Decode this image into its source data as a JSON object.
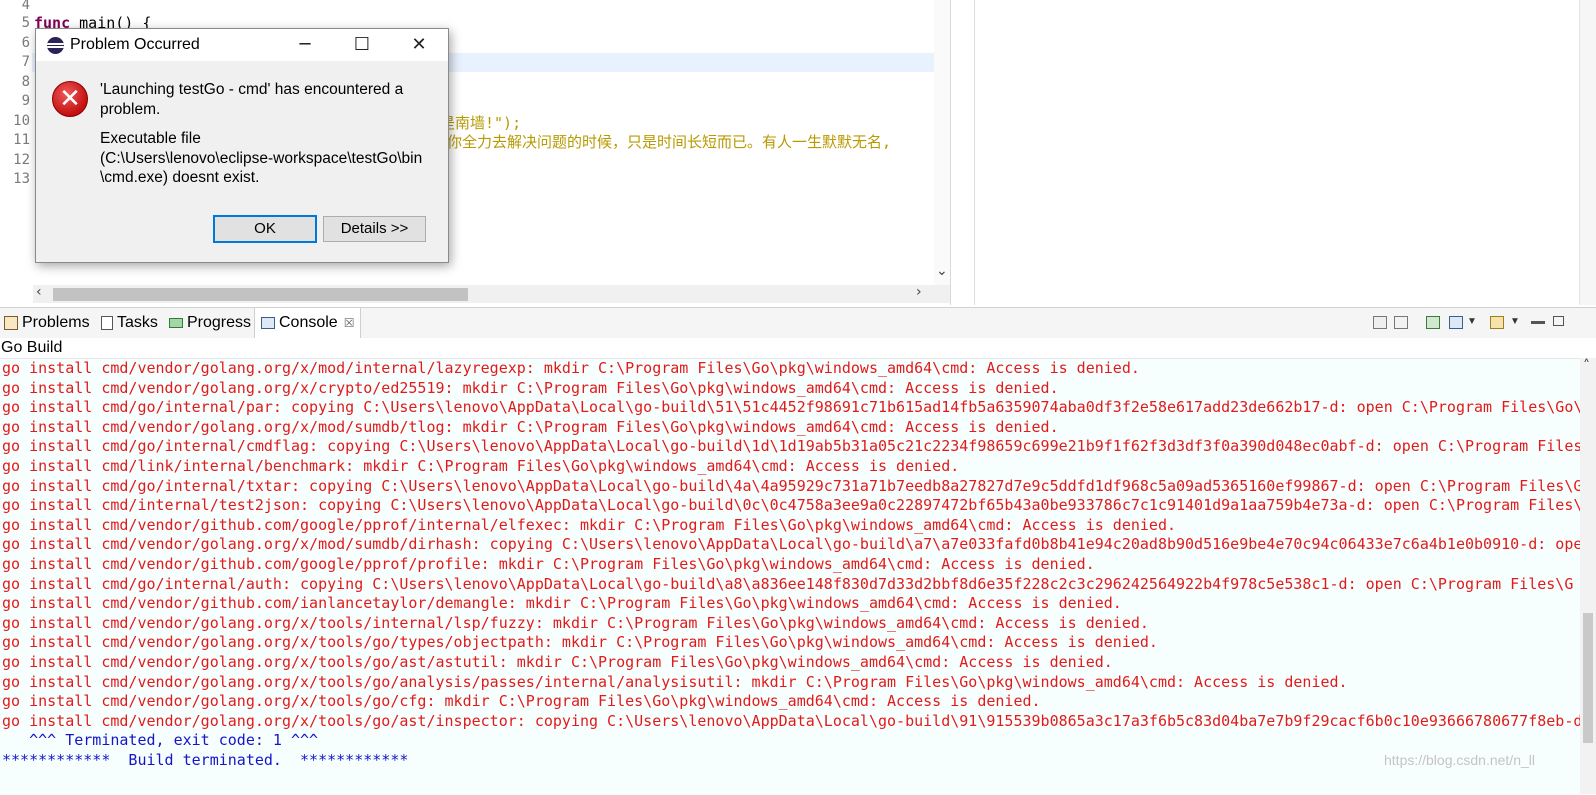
{
  "editor": {
    "line_numbers": [
      "4",
      "5",
      "6",
      "7",
      "8",
      "9",
      "10",
      "11",
      "12",
      "13"
    ],
    "line5_keyword": "func",
    "line5_rest": " main() {",
    "line10_fragment": "是南墙!\");",
    "line11_fragment": "你全力去解决问题的时候，只是时间长短而已。有人一生默默无名,"
  },
  "dialog": {
    "title": "Problem Occurred",
    "message_line1": "'Launching testGo - cmd' has encountered a",
    "message_line2": "problem.",
    "detail_line1": "Executable file",
    "detail_line2": "(C:\\Users\\lenovo\\eclipse-workspace\\testGo\\bin",
    "detail_line3": "\\cmd.exe) doesnt exist.",
    "ok_label": "OK",
    "details_label": "Details >>",
    "icon": "error-icon"
  },
  "console": {
    "tabs": [
      {
        "label": "Problems",
        "icon": "problems-icon"
      },
      {
        "label": "Tasks",
        "icon": "tasks-icon"
      },
      {
        "label": "Progress",
        "icon": "progress-icon"
      },
      {
        "label": "Console",
        "icon": "console-icon",
        "close": "☒"
      }
    ],
    "title": "Go Build",
    "error_lines": [
      "go install cmd/vendor/golang.org/x/mod/internal/lazyregexp: mkdir C:\\Program Files\\Go\\pkg\\windows_amd64\\cmd: Access is denied.",
      "go install cmd/vendor/golang.org/x/crypto/ed25519: mkdir C:\\Program Files\\Go\\pkg\\windows_amd64\\cmd: Access is denied.",
      "go install cmd/go/internal/par: copying C:\\Users\\lenovo\\AppData\\Local\\go-build\\51\\51c4452f98691c71b615ad14fb5a6359074aba0df3f2e58e617add23de662b17-d: open C:\\Program Files\\Go\\p",
      "go install cmd/vendor/golang.org/x/mod/sumdb/tlog: mkdir C:\\Program Files\\Go\\pkg\\windows_amd64\\cmd: Access is denied.",
      "go install cmd/go/internal/cmdflag: copying C:\\Users\\lenovo\\AppData\\Local\\go-build\\1d\\1d19ab5b31a05c21c2234f98659c699e21b9f1f62f3d3df3f0a390d048ec0abf-d: open C:\\Program Files\\",
      "go install cmd/link/internal/benchmark: mkdir C:\\Program Files\\Go\\pkg\\windows_amd64\\cmd: Access is denied.",
      "go install cmd/go/internal/txtar: copying C:\\Users\\lenovo\\AppData\\Local\\go-build\\4a\\4a95929c731a71b7eedb8a27827d7e9c5ddfd1df968c5a09ad5365160ef99867-d: open C:\\Program Files\\Go",
      "go install cmd/internal/test2json: copying C:\\Users\\lenovo\\AppData\\Local\\go-build\\0c\\0c4758a3ee9a0c22897472bf65b43a0be933786c7c1c91401d9a1aa759b4e73a-d: open C:\\Program Files\\(",
      "go install cmd/vendor/github.com/google/pprof/internal/elfexec: mkdir C:\\Program Files\\Go\\pkg\\windows_amd64\\cmd: Access is denied.",
      "go install cmd/vendor/golang.org/x/mod/sumdb/dirhash: copying C:\\Users\\lenovo\\AppData\\Local\\go-build\\a7\\a7e033fafd0b8b41e94c20ad8b90d516e9be4e70c94c06433e7c6a4b1e0b0910-d: oper",
      "go install cmd/vendor/github.com/google/pprof/profile: mkdir C:\\Program Files\\Go\\pkg\\windows_amd64\\cmd: Access is denied.",
      "go install cmd/go/internal/auth: copying C:\\Users\\lenovo\\AppData\\Local\\go-build\\a8\\a836ee148f830d7d33d2bbf8d6e35f228c2c3c296242564922b4f978c5e538c1-d: open C:\\Program Files\\G",
      "go install cmd/vendor/github.com/ianlancetaylor/demangle: mkdir C:\\Program Files\\Go\\pkg\\windows_amd64\\cmd: Access is denied.",
      "go install cmd/vendor/golang.org/x/tools/internal/lsp/fuzzy: mkdir C:\\Program Files\\Go\\pkg\\windows_amd64\\cmd: Access is denied.",
      "go install cmd/vendor/golang.org/x/tools/go/types/objectpath: mkdir C:\\Program Files\\Go\\pkg\\windows_amd64\\cmd: Access is denied.",
      "go install cmd/vendor/golang.org/x/tools/go/ast/astutil: mkdir C:\\Program Files\\Go\\pkg\\windows_amd64\\cmd: Access is denied.",
      "go install cmd/vendor/golang.org/x/tools/go/analysis/passes/internal/analysisutil: mkdir C:\\Program Files\\Go\\pkg\\windows_amd64\\cmd: Access is denied.",
      "go install cmd/vendor/golang.org/x/tools/go/cfg: mkdir C:\\Program Files\\Go\\pkg\\windows_amd64\\cmd: Access is denied.",
      "go install cmd/vendor/golang.org/x/tools/go/ast/inspector: copying C:\\Users\\lenovo\\AppData\\Local\\go-build\\91\\915539b0865a3c17a3f6b5c83d04ba7e7b9f29cacf6b0c10e93666780677f8eb-d:"
    ],
    "terminated_line": "   ^^^ Terminated, exit code: 1 ^^^",
    "build_terminated_line": "************  Build terminated.  ************",
    "watermark": "https://blog.csdn.net/n_ll"
  },
  "colors": {
    "error_text": "#e11b1b",
    "info_text": "#1515c8",
    "console_bg": "#f7fffe",
    "keyword": "#7f0055",
    "string": "#b89a00"
  }
}
